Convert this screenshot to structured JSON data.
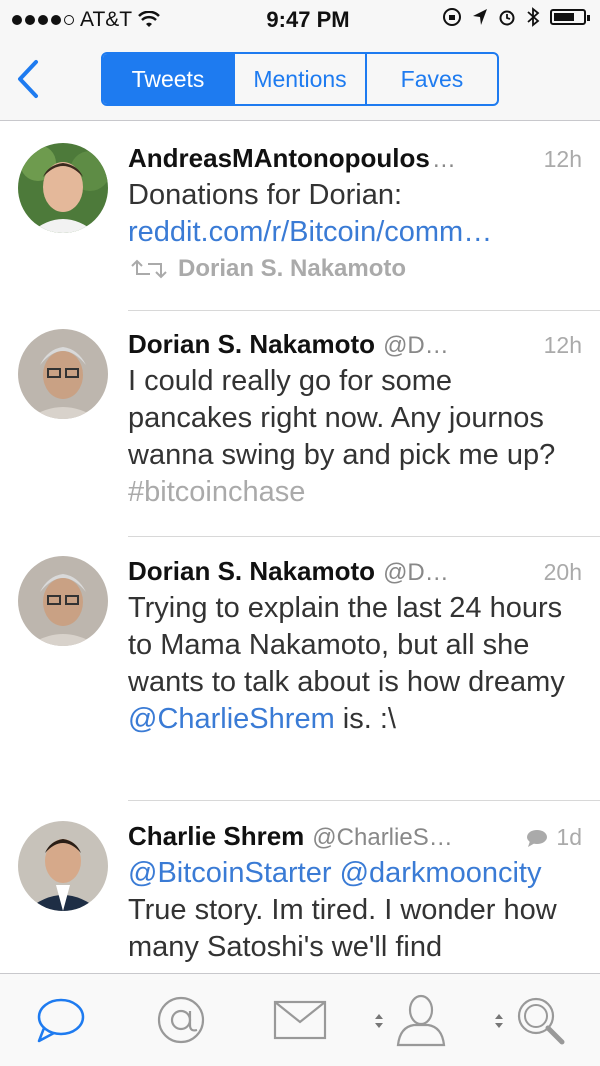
{
  "status": {
    "carrier": "AT&T",
    "time": "9:47 PM"
  },
  "segments": {
    "tweets": "Tweets",
    "mentions": "Mentions",
    "faves": "Faves"
  },
  "tweets": [
    {
      "name": "AndreasMAntonopoulos",
      "handle": "…",
      "time": "12h",
      "body_text": "Donations for Dorian:",
      "link": "reddit.com/r/Bitcoin/comm…",
      "retweeted_by": "Dorian S. Nakamoto"
    },
    {
      "name": "Dorian S. Nakamoto",
      "handle": "@D…",
      "time": "12h",
      "body_text": "I could really go for some pancakes right now.  Any journos wanna swing by and pick me up?",
      "hashtag": "#bitcoinchase"
    },
    {
      "name": "Dorian S. Nakamoto",
      "handle": "@D…",
      "time": "20h",
      "body_pre": "Trying to explain the last 24 hours to Mama Nakamoto, but all she wants to talk about is how dreamy ",
      "mention": "@CharlieShrem",
      "body_post": " is. :\\"
    },
    {
      "name": "Charlie Shrem",
      "handle": "@CharlieS…",
      "time": "1d",
      "mentions": "@BitcoinStarter @darkmooncity",
      "body_text": "True story. Im tired. I wonder how many Satoshi's we'll find"
    }
  ],
  "tabbar": [
    "chat-bubble-icon",
    "at-sign-icon",
    "envelope-icon",
    "person-icon",
    "search-icon"
  ],
  "colors": {
    "accent": "#1e7bf0",
    "link": "#3a7bd5",
    "muted": "#aaaaaa"
  }
}
